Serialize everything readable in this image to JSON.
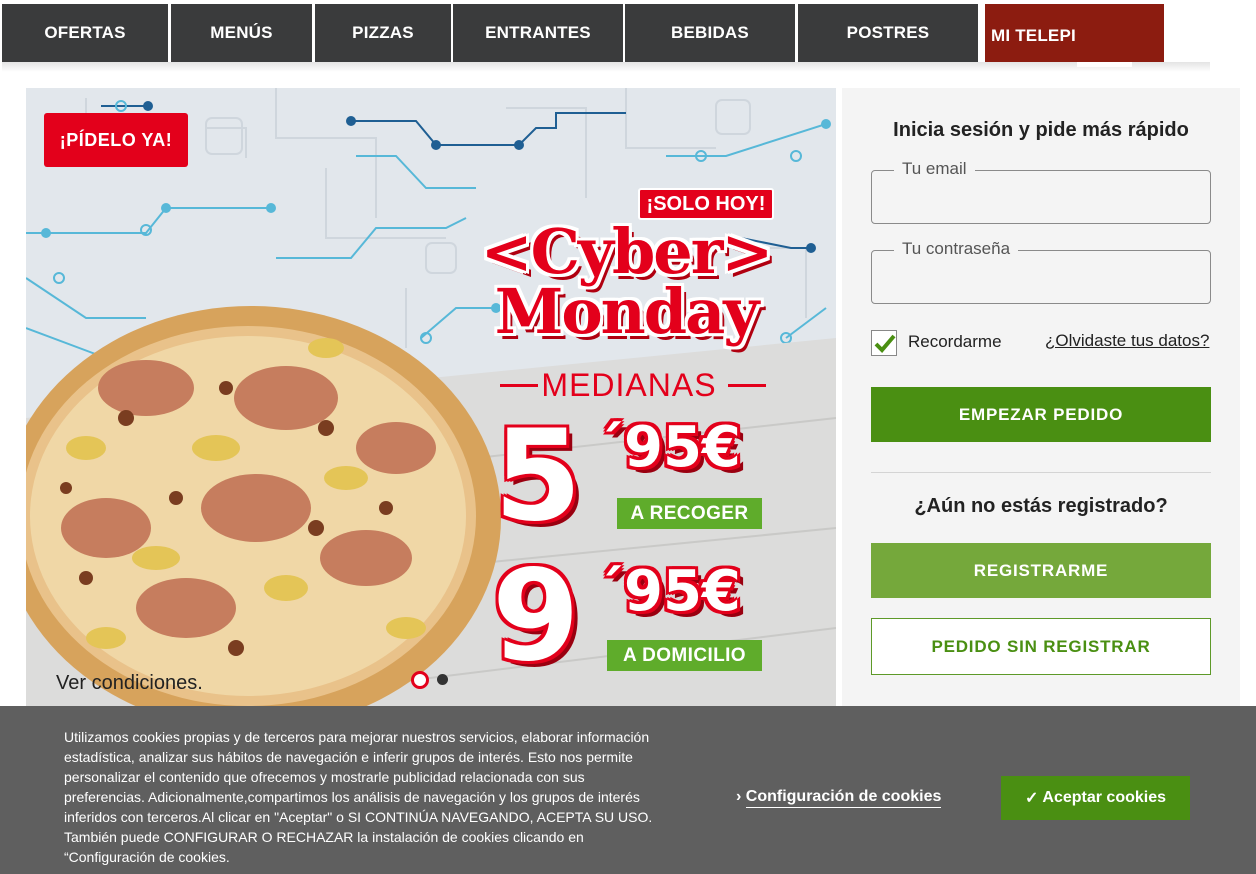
{
  "nav": {
    "items": [
      {
        "label": "OFERTAS"
      },
      {
        "label": "MENÚS"
      },
      {
        "label": "PIZZAS"
      },
      {
        "label": "ENTRANTES"
      },
      {
        "label": "BEBIDAS"
      },
      {
        "label": "POSTRES"
      }
    ],
    "account_label": "MI TELEPI"
  },
  "hero": {
    "order_button": "¡PÍDELO YA!",
    "badge": "¡SOLO HOY!",
    "headline_1": "<Cyber>",
    "headline_2": "Monday",
    "subheading": "MEDIANAS",
    "offer_pickup": {
      "price_main": "5",
      "price_cents": "´95€",
      "label": "A RECOGER"
    },
    "offer_delivery": {
      "price_main": "9",
      "price_cents": "´95€",
      "label": "A DOMICILIO"
    },
    "conditions_link": "Ver condiciones.",
    "carousel": {
      "slides": 2,
      "active": 1
    },
    "colors": {
      "red": "#e3001b",
      "green": "#5fac2b"
    }
  },
  "login": {
    "title": "Inicia sesión y pide más rápido",
    "email_label": "Tu email",
    "email_value": "",
    "password_label": "Tu contraseña",
    "password_value": "",
    "remember_label": "Recordarme",
    "remember_checked": true,
    "forgot_link": "¿Olvidaste tus datos?",
    "start_button": "EMPEZAR PEDIDO",
    "not_registered": "¿Aún no estás registrado?",
    "register_button": "REGISTRARME",
    "guest_button": "PEDIDO SIN REGISTRAR"
  },
  "cookies": {
    "text_lines": [
      "Utilizamos cookies propias y de terceros para mejorar nuestros servicios, elaborar información",
      "estadística, analizar sus hábitos de navegación e inferir grupos de interés. Esto nos permite",
      "personalizar el contenido que ofrecemos y mostrarle publicidad relacionada con sus",
      "preferencias. Adicionalmente,compartimos los análisis de navegación y los grupos de interés",
      "inferidos con terceros.Al clicar en \"Aceptar\" o SI CONTINÚA NAVEGANDO, ACEPTA SU USO.",
      "También puede CONFIGURAR O RECHAZAR la instalación de cookies clicando en",
      "“Configuración de cookies."
    ],
    "config_link": "Configuración de cookies",
    "accept_button": "Aceptar cookies"
  }
}
